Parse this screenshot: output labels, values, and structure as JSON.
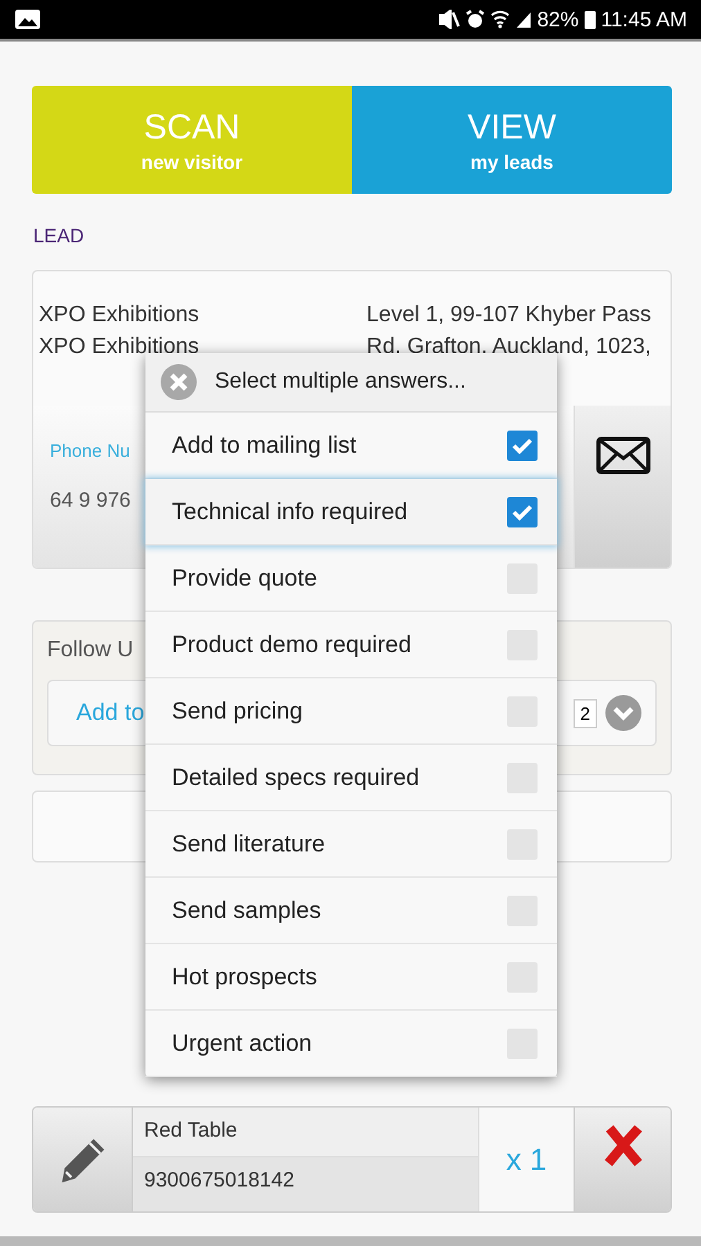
{
  "status_bar": {
    "battery": "82%",
    "time": "11:45 AM"
  },
  "actions": [
    {
      "kind": "scan",
      "title": "SCAN",
      "subtitle": "new visitor"
    },
    {
      "kind": "view",
      "title": "VIEW",
      "subtitle": "my leads"
    }
  ],
  "section_label": "LEAD",
  "lead": {
    "company_lines": [
      "XPO Exhibitions",
      "XPO Exhibitions"
    ],
    "address_lines": [
      "Level 1, 99-107 Khyber Pass",
      "Rd, Grafton, Auckland, 1023,"
    ],
    "phone_label": "Phone Nu",
    "phone": "64 9 976"
  },
  "follow_up": {
    "label": "Follow U",
    "link": "Add to",
    "count": "2"
  },
  "dialog": {
    "title": "Select multiple answers...",
    "options": [
      {
        "label": "Add to mailing list",
        "checked": true,
        "highlighted": false
      },
      {
        "label": "Technical info required",
        "checked": true,
        "highlighted": true
      },
      {
        "label": "Provide quote",
        "checked": false,
        "highlighted": false
      },
      {
        "label": "Product demo required",
        "checked": false,
        "highlighted": false
      },
      {
        "label": "Send pricing",
        "checked": false,
        "highlighted": false
      },
      {
        "label": "Detailed specs required",
        "checked": false,
        "highlighted": false
      },
      {
        "label": "Send literature",
        "checked": false,
        "highlighted": false
      },
      {
        "label": "Send samples",
        "checked": false,
        "highlighted": false
      },
      {
        "label": "Hot prospects",
        "checked": false,
        "highlighted": false
      },
      {
        "label": "Urgent action",
        "checked": false,
        "highlighted": false
      }
    ]
  },
  "item": {
    "name": "Red Table",
    "code": "9300675018142",
    "quantity": "x 1"
  }
}
